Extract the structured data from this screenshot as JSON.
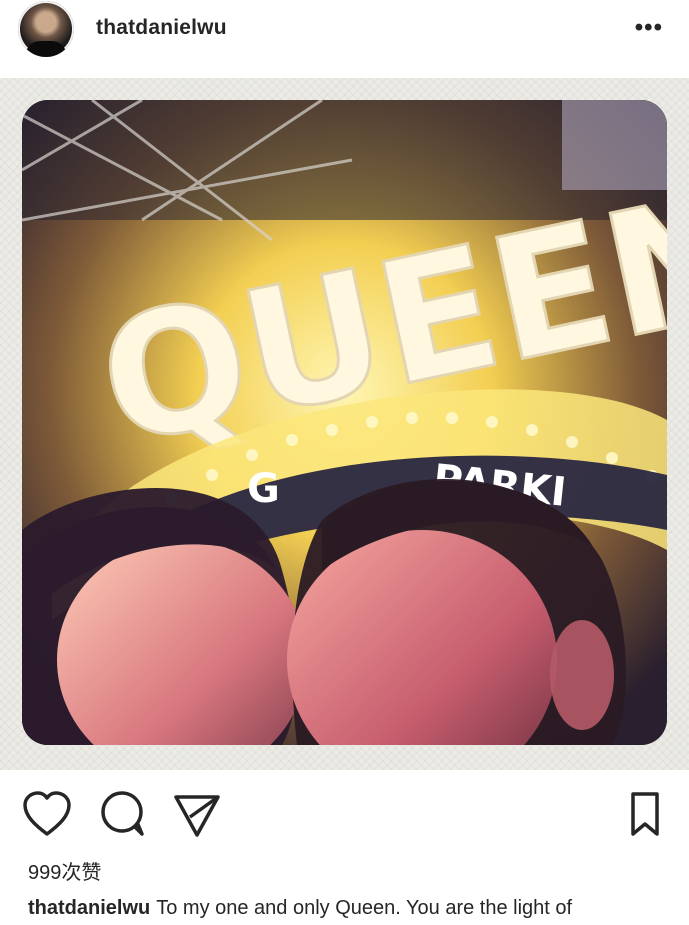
{
  "post": {
    "username": "thatdanielwu",
    "more_icon": "more-icon",
    "likes": "999次赞",
    "caption_user": "thatdanielwu",
    "caption_text": "To my one and only Queen. You are the light of"
  },
  "photo": {
    "sign_text": "QUEENS",
    "parking_text": "PARKI",
    "g_text": "G"
  },
  "actions": [
    "heart-icon",
    "comment-icon",
    "share-icon",
    "bookmark-icon"
  ]
}
